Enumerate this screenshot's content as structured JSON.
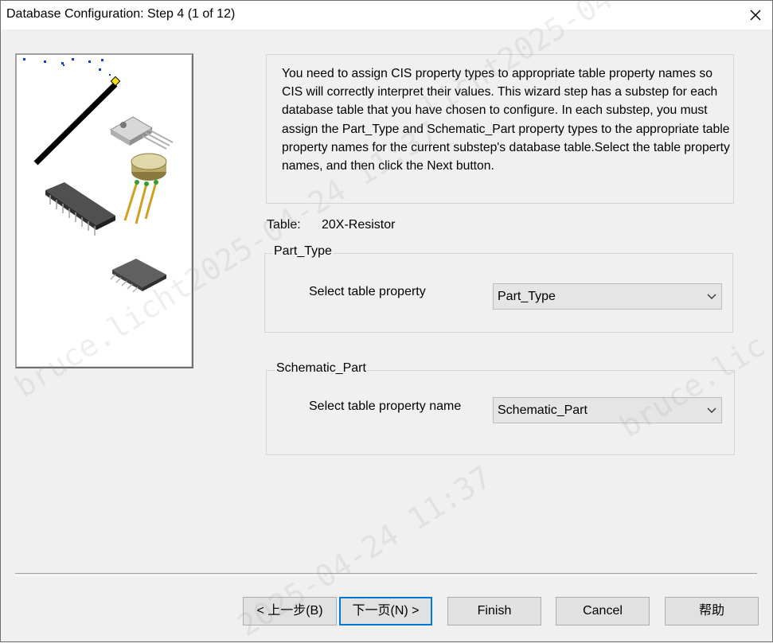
{
  "window": {
    "title": "Database Configuration: Step 4 (1 of 12)"
  },
  "instructions": "You need to assign CIS property types to appropriate table property names so CIS will correctly interpret their values. This wizard step has a substep for each database table that you have chosen to configure. In each substep, you must assign the Part_Type and Schematic_Part property types to the appropriate table property names for the current substep's database table.Select the table property names, and then click the Next button.",
  "table": {
    "label": "Table:",
    "value": "20X-Resistor"
  },
  "part_type": {
    "legend": "Part_Type",
    "field_label": "Select table property",
    "selected": "Part_Type"
  },
  "schematic_part": {
    "legend": "Schematic_Part",
    "field_label": "Select table property name",
    "selected": "Schematic_Part"
  },
  "buttons": {
    "back": "< 上一步(B)",
    "next": "下一页(N) >",
    "finish": "Finish",
    "cancel": "Cancel",
    "help": "帮助"
  },
  "watermarks": [
    "bruce.licht2025-04-24 11:37",
    "licht2025-04-24 11:37",
    "2025-04-24 11:37",
    "bruce.lic"
  ],
  "colors": {
    "default_button_border": "#0078d7",
    "dialog_background": "#f0f0f0"
  },
  "icons": {
    "close": "close-icon",
    "combo_dropdown": "chevron-down-icon"
  }
}
